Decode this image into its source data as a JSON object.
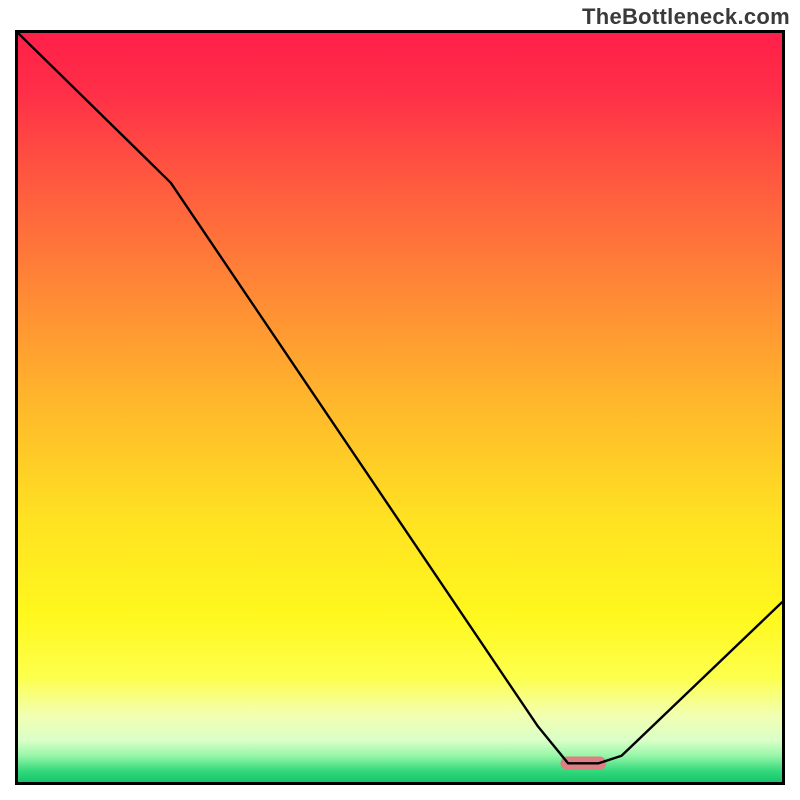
{
  "watermark": "TheBottleneck.com",
  "chart_data": {
    "type": "line",
    "title": "",
    "xlabel": "",
    "ylabel": "",
    "xlim": [
      0,
      100
    ],
    "ylim": [
      0,
      100
    ],
    "grid": false,
    "legend": false,
    "series": [
      {
        "name": "bottleneck-curve",
        "stroke": "#000000",
        "x": [
          0,
          20,
          68,
          72,
          76,
          79,
          100
        ],
        "y": [
          100,
          80,
          7.5,
          2.5,
          2.5,
          3.5,
          24
        ]
      }
    ],
    "annotations": [
      {
        "name": "optimal-marker",
        "shape": "capsule",
        "x_center": 74,
        "y_center": 2.5,
        "width": 6,
        "height": 1.8,
        "fill": "#de7f84"
      }
    ],
    "background": {
      "type": "linear-gradient",
      "direction": "vertical",
      "stops": [
        {
          "offset": 0.0,
          "color": "#ff1f49"
        },
        {
          "offset": 0.08,
          "color": "#ff2f48"
        },
        {
          "offset": 0.2,
          "color": "#ff5a3f"
        },
        {
          "offset": 0.35,
          "color": "#ff8a35"
        },
        {
          "offset": 0.5,
          "color": "#ffb92b"
        },
        {
          "offset": 0.65,
          "color": "#ffe222"
        },
        {
          "offset": 0.78,
          "color": "#fff81e"
        },
        {
          "offset": 0.86,
          "color": "#fdff4d"
        },
        {
          "offset": 0.91,
          "color": "#f3ffb0"
        },
        {
          "offset": 0.945,
          "color": "#d9ffc8"
        },
        {
          "offset": 0.965,
          "color": "#97f6a8"
        },
        {
          "offset": 0.985,
          "color": "#34d97c"
        },
        {
          "offset": 1.0,
          "color": "#14c66a"
        }
      ]
    }
  }
}
